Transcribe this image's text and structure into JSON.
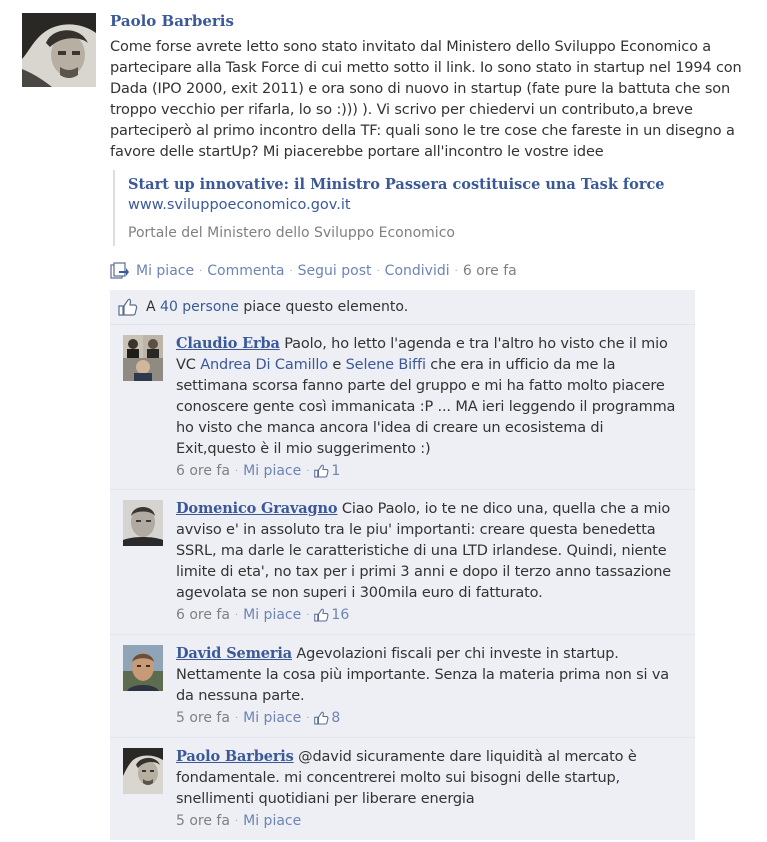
{
  "post": {
    "author": "Paolo Barberis",
    "text": "Come forse avrete letto sono stato invitato dal Ministero dello Sviluppo Economico a partecipare alla Task Force di cui metto sotto il link. Io sono stato in startup nel 1994 con Dada (IPO 2000, exit 2011) e ora sono di nuovo in startup (fate pure la battuta che son troppo vecchio per rifarla, lo so :))) ). Vi scrivo per chiedervi un contributo,a breve parteciperò al primo incontro della TF: quali sono le tre cose che fareste in un disegno a favore delle startUp? Mi piacerebbe portare all'incontro le vostre idee",
    "link": {
      "title": "Start up innovative: il Ministro Passera costituisce una Task force",
      "url": "www.sviluppoeconomico.gov.it",
      "description": "Portale del Ministero dello Sviluppo Economico"
    },
    "actions": {
      "like": "Mi piace",
      "comment": "Commenta",
      "follow": "Segui post",
      "share": "Condividi",
      "time": "6 ore fa"
    }
  },
  "likes": {
    "prefix": "A",
    "people": "40 persone",
    "suffix": "piace questo elemento."
  },
  "comments": [
    {
      "author": "Claudio Erba",
      "text_1": " Paolo, ho letto l'agenda e tra l'altro ho visto che il mio VC ",
      "mention_1": "Andrea Di Camillo",
      "text_2": " e ",
      "mention_2": "Selene Biffi",
      "text_3": " che era in ufficio da me la settimana scorsa fanno parte del gruppo e mi ha fatto molto piacere conoscere gente così immanicata :P ... MA ieri leggendo il programma ho visto che manca ancora l'idea di creare un ecosistema di Exit,questo è il mio suggerimento :)",
      "time": "6 ore fa",
      "like": "Mi piace",
      "like_count": "1"
    },
    {
      "author": "Domenico Gravagno",
      "text": " Ciao Paolo, io te ne dico una, quella che a mio avviso e' in assoluto tra le piu' importanti: creare questa benedetta SSRL, ma darle le caratteristiche di una LTD irlandese. Quindi, niente limite di eta', no tax per i primi 3 anni e dopo il terzo anno tassazione agevolata se non superi i 300mila euro di fatturato.",
      "time": "6 ore fa",
      "like": "Mi piace",
      "like_count": "16"
    },
    {
      "author": "David Semeria",
      "text": " Agevolazioni fiscali per chi investe in startup. Nettamente la cosa più importante. Senza la materia prima non si va da nessuna parte.",
      "time": "5 ore fa",
      "like": "Mi piace",
      "like_count": "8"
    },
    {
      "author": "Paolo Barberis",
      "text": " @david sicuramente dare liquidità al mercato è fondamentale. mi concentrerei molto sui bisogni delle startup, snellimenti quotidiani per liberare energia",
      "time": "5 ore fa",
      "like": "Mi piace"
    }
  ],
  "colors": {
    "link": "#3b5998",
    "ufi_bg": "#edeff4",
    "meta": "#808080"
  },
  "icons": {
    "share": "share-icon",
    "like": "thumbs-up-icon"
  }
}
